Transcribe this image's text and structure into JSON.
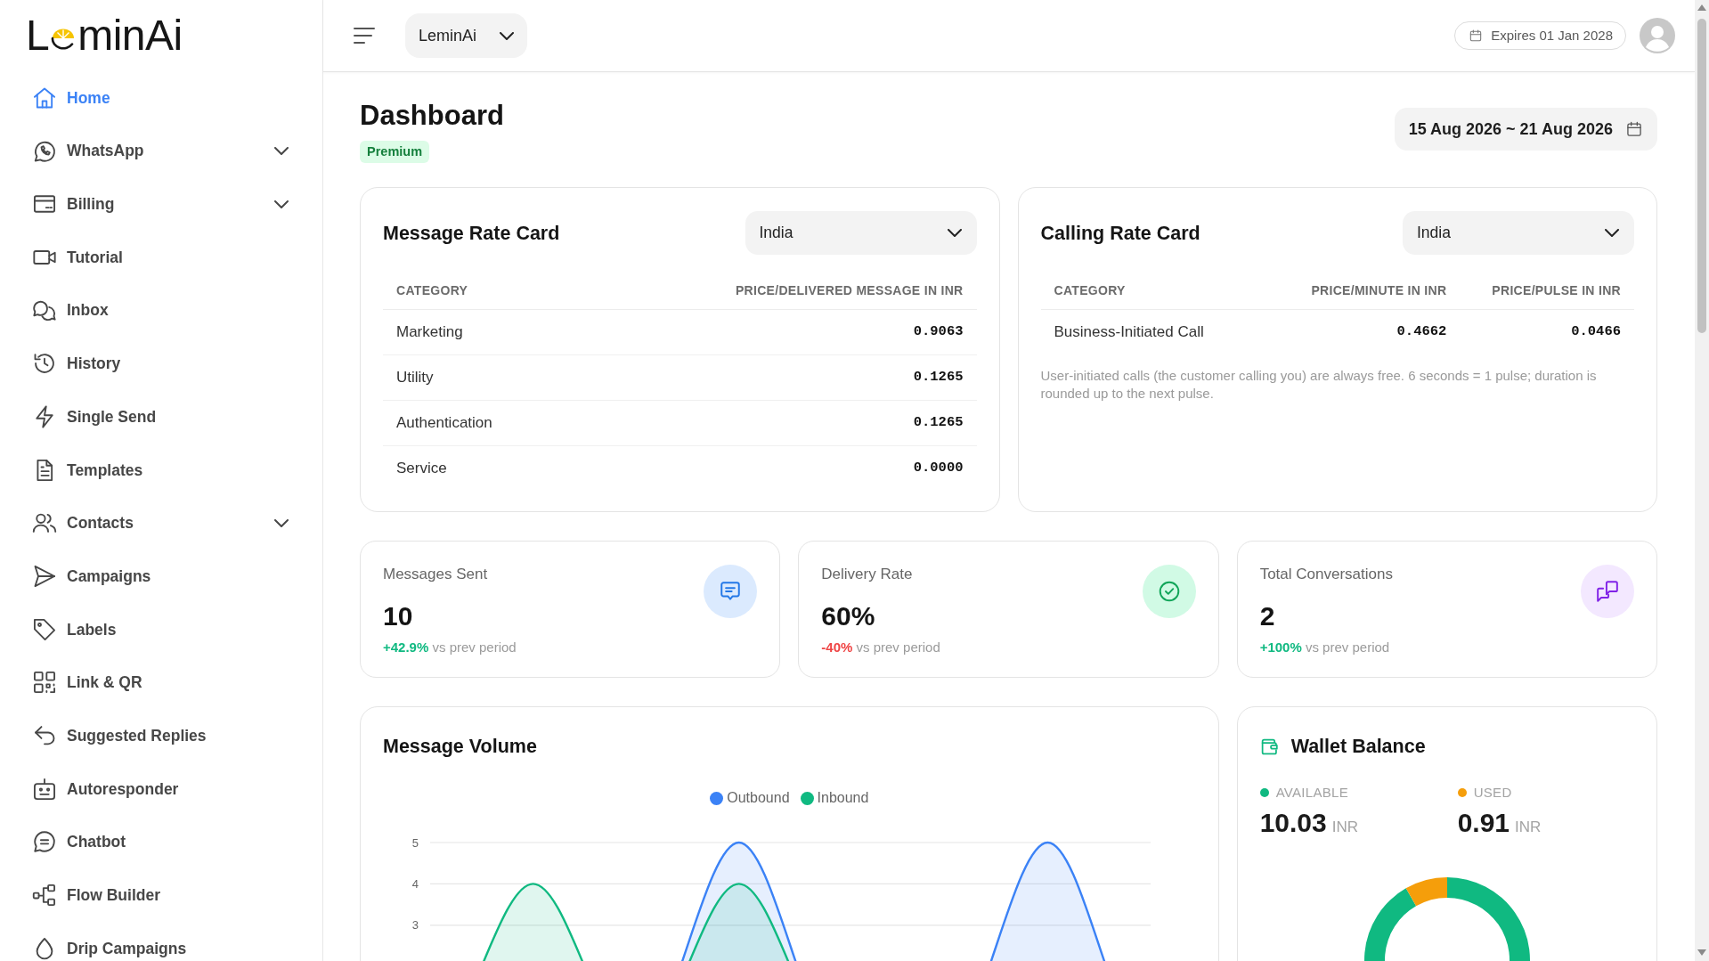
{
  "sidebar": {
    "logo": {
      "start": "L",
      "end": "minAi"
    },
    "items": [
      {
        "label": "Home",
        "kind": "link",
        "selected": true
      },
      {
        "label": "WhatsApp",
        "kind": "group",
        "selected": false
      },
      {
        "label": "Billing",
        "kind": "group",
        "selected": false
      },
      {
        "label": "Tutorial",
        "kind": "link",
        "selected": false
      },
      {
        "label": "Inbox",
        "kind": "link",
        "selected": false
      },
      {
        "label": "History",
        "kind": "link",
        "selected": false
      },
      {
        "label": "Single Send",
        "kind": "link",
        "selected": false
      },
      {
        "label": "Templates",
        "kind": "link",
        "selected": false
      },
      {
        "label": "Contacts",
        "kind": "group",
        "selected": false
      },
      {
        "label": "Campaigns",
        "kind": "link",
        "selected": false
      },
      {
        "label": "Labels",
        "kind": "link",
        "selected": false
      },
      {
        "label": "Link & QR",
        "kind": "link",
        "selected": false
      },
      {
        "label": "Suggested Replies",
        "kind": "link",
        "selected": false
      },
      {
        "label": "Autoresponder",
        "kind": "link",
        "selected": false
      },
      {
        "label": "Chatbot",
        "kind": "link",
        "selected": false
      },
      {
        "label": "Flow Builder",
        "kind": "link",
        "selected": false
      },
      {
        "label": "Drip Campaigns",
        "kind": "link",
        "selected": false
      }
    ]
  },
  "header": {
    "workspace": "LeminAi",
    "expiry": "Expires 01 Jan 2028"
  },
  "page": {
    "title": "Dashboard",
    "plan": "Premium",
    "date_range": "15 Aug 2026 ~ 21 Aug 2026"
  },
  "message_rate_card": {
    "title": "Message Rate Card",
    "country": "India",
    "columns": [
      "CATEGORY",
      "PRICE/DELIVERED MESSAGE IN INR"
    ],
    "rows": [
      [
        "Marketing",
        "0.9063"
      ],
      [
        "Utility",
        "0.1265"
      ],
      [
        "Authentication",
        "0.1265"
      ],
      [
        "Service",
        "0.0000"
      ]
    ]
  },
  "calling_rate_card": {
    "title": "Calling Rate Card",
    "country": "India",
    "columns": [
      "CATEGORY",
      "PRICE/MINUTE IN INR",
      "PRICE/PULSE IN INR"
    ],
    "rows": [
      [
        "Business-Initiated Call",
        "0.4662",
        "0.0466"
      ]
    ],
    "note": "User-initiated calls (the customer calling you) are always free. 6 seconds = 1 pulse; duration is rounded up to the next pulse."
  },
  "stats": [
    {
      "label": "Messages Sent",
      "value": "10",
      "change": "+42.9%",
      "positive": true,
      "comparison": "vs prev period",
      "color": "#dbeafe"
    },
    {
      "label": "Delivery Rate",
      "value": "60%",
      "change": "-40%",
      "positive": false,
      "comparison": "vs prev period",
      "color": "#d1fae5"
    },
    {
      "label": "Total Conversations",
      "value": "2",
      "change": "+100%",
      "positive": true,
      "comparison": "vs prev period",
      "color": "#f3e8ff"
    }
  ],
  "message_volume": {
    "title": "Message Volume",
    "chart_data": {
      "type": "area",
      "legend": "top",
      "series": [
        {
          "name": "Outbound",
          "color": "#3b82f6",
          "values": [
            0,
            0,
            0,
            5,
            0,
            0,
            5,
            0
          ]
        },
        {
          "name": "Inbound",
          "color": "#10b981",
          "values": [
            0,
            4,
            0,
            4,
            0,
            0,
            0,
            0
          ]
        }
      ],
      "ylim": [
        0,
        5
      ],
      "yticks": [
        3,
        4,
        5
      ]
    }
  },
  "wallet": {
    "title": "Wallet Balance",
    "items": [
      {
        "label": "AVAILABLE",
        "color": "#10b981",
        "amount": "10.03",
        "unit": "INR"
      },
      {
        "label": "USED",
        "color": "#f59e0b",
        "amount": "0.91",
        "unit": "INR"
      }
    ],
    "chart_data": {
      "type": "donut",
      "values": [
        91.7,
        8.3
      ]
    }
  }
}
